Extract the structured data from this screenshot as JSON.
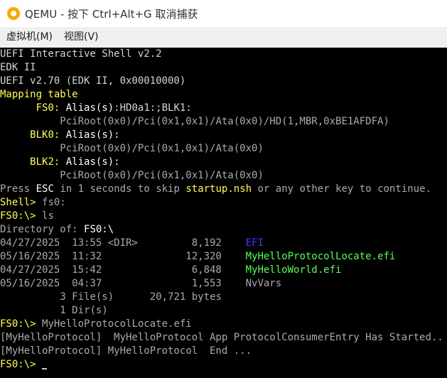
{
  "window": {
    "title": "QEMU - 按下 Ctrl+Alt+G 取消捕获",
    "icon": "qemu-icon"
  },
  "menu": {
    "items": [
      "虚拟机(M)",
      "视图(V)"
    ]
  },
  "terminal": {
    "header": {
      "shell_version": "UEFI Interactive Shell v2.2",
      "edk": "EDK II",
      "uefi_version": "UEFI v2.70 (EDK II, 0x00010000)"
    },
    "mapping": {
      "title": "Mapping table",
      "fs0_name": "FS0:",
      "fs0_alias_label": "Alias(s)",
      "fs0_alias_value": ":HD0a1:;BLK1:",
      "fs0_path": "PciRoot(0x0)/Pci(0x1,0x1)/Ata(0x0)/HD(1,MBR,0xBE1AFDFA)",
      "blk0_name": "BLK0:",
      "blk0_alias_label": "Alias(s):",
      "blk0_path": "PciRoot(0x0)/Pci(0x1,0x1)/Ata(0x0)",
      "blk2_name": "BLK2:",
      "blk2_alias_label": "Alias(s):",
      "blk2_path": "PciRoot(0x0)/Pci(0x1,0x1)/Ata(0x0)"
    },
    "startup": {
      "press": "Press",
      "esc": "ESC",
      "mid": "in 1 seconds to skip",
      "script": "startup.nsh",
      "tail": "or any other key to continue."
    },
    "cmd1": {
      "prompt": "Shell>",
      "text": "fs0:"
    },
    "cmd2": {
      "prompt": "FS0:\\>",
      "text": "ls"
    },
    "directory": {
      "label": "Directory of:",
      "path": "FS0:\\"
    },
    "listing": {
      "row1": {
        "info": "04/27/2025  13:55 <DIR>         8,192",
        "name": "EFI"
      },
      "row2": {
        "info": "05/16/2025  11:32              12,320",
        "name": "MyHelloProtocolLocate.efi"
      },
      "row3": {
        "info": "04/27/2025  15:42               6,848",
        "name": "MyHelloWorld.efi"
      },
      "row4": {
        "info": "05/16/2025  04:37               1,553",
        "name": "NvVars"
      }
    },
    "summary": {
      "files": "3 File(s)      20,721 bytes",
      "dirs": "1 Dir(s)"
    },
    "cmd3": {
      "prompt": "FS0:\\>",
      "text": "MyHelloProtocolLocate.efi"
    },
    "output": {
      "line1": "[MyHelloProtocol]  MyHelloProtocol App ProtocolConsumerEntry Has Started..",
      "line2": "[MyHelloProtocol] MyHelloProtocol  End ..."
    },
    "cmd4": {
      "prompt": "FS0:\\>"
    }
  },
  "colors": {
    "terminal_bg": "#000000",
    "text_gray": "#aaaaaa",
    "highlight_yellow": "#ffff55",
    "dir_blue": "#3b3bff",
    "exec_green": "#55ff55"
  }
}
